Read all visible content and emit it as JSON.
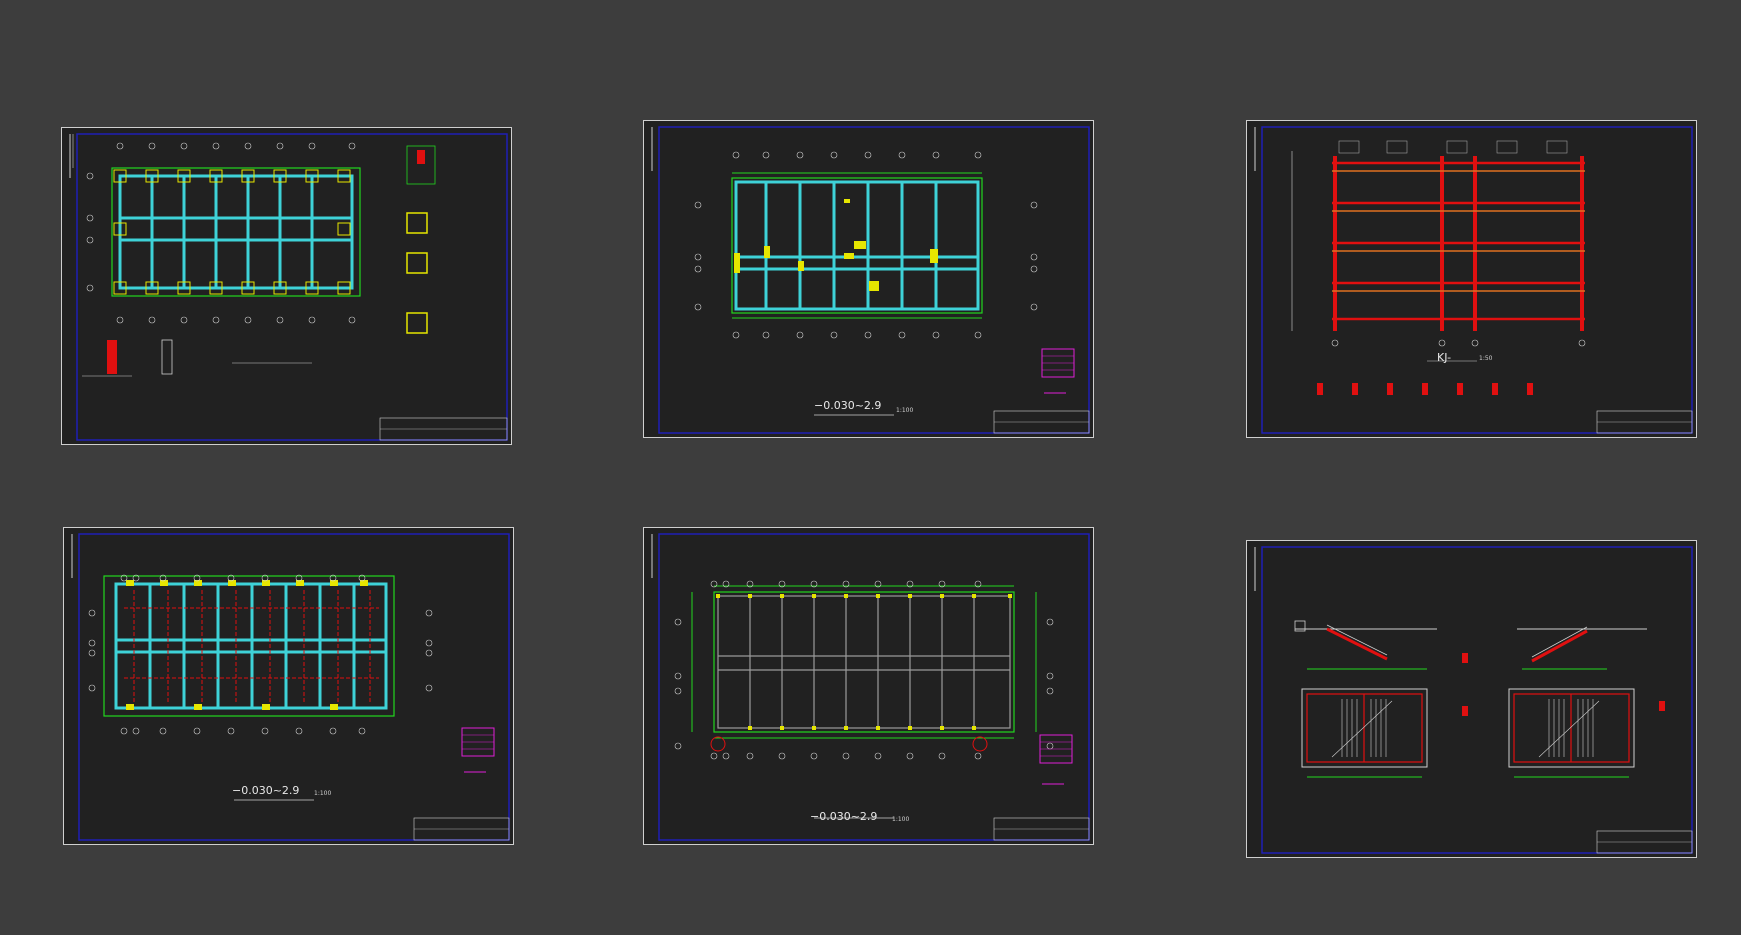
{
  "colors": {
    "background": "#3d3d3d",
    "sheet": "#212121",
    "frame": "#1f1fb5",
    "grid": "#22d61e",
    "beam": "#3ed2d8",
    "column": "#e6e600",
    "rebar": "#e01010",
    "dim": "#d0d0d0",
    "magenta": "#e01fd8",
    "orange": "#e07020"
  },
  "sheets": [
    {
      "id": "foundation-plan",
      "type": "plan-foundation",
      "title": "",
      "scale": ""
    },
    {
      "id": "beam-plan",
      "type": "plan-beams",
      "title": "−0.030~2.9",
      "scale": "1:100"
    },
    {
      "id": "frame-elevation",
      "type": "elevation-frame",
      "title": "KJ-",
      "scale": "1:50"
    },
    {
      "id": "slab-reinforcement-plan",
      "type": "plan-slab",
      "title": "−0.030~2.9",
      "scale": "1:100"
    },
    {
      "id": "column-plan",
      "type": "plan-columns",
      "title": "−0.030~2.9",
      "scale": "1:100"
    },
    {
      "id": "stair-details",
      "type": "stair-details",
      "title": "",
      "scale": ""
    }
  ]
}
